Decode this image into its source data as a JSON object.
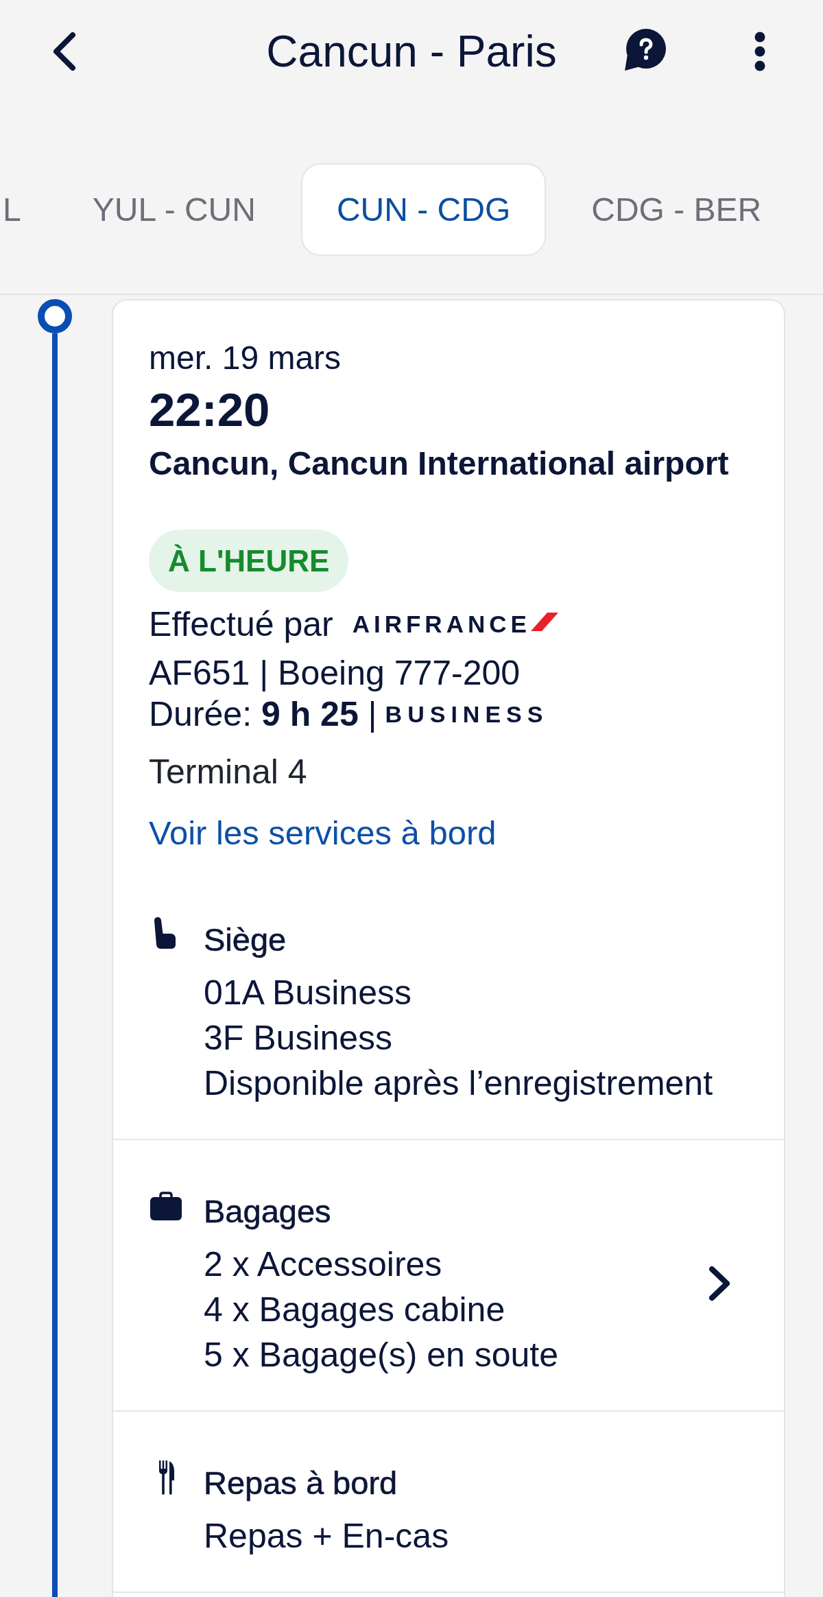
{
  "header": {
    "title": "Cancun - Paris"
  },
  "tabs": [
    {
      "label": "L",
      "selected": false
    },
    {
      "label": "YUL - CUN",
      "selected": false
    },
    {
      "label": "CUN - CDG",
      "selected": true
    },
    {
      "label": "CDG - BER",
      "selected": false
    }
  ],
  "segment": {
    "date": "mer. 19 mars",
    "time": "22:20",
    "airport": "Cancun, Cancun International airport",
    "status": {
      "label": "À L'HEURE",
      "kind": "on_time"
    },
    "operated_by": "Effectué par",
    "airline_logo": "AIRFRANCE",
    "flight": "AF651 | Boeing 777-200",
    "duration": "Durée: **9 h 25** |",
    "cabin": "BUSINESS",
    "terminal": "Terminal 4",
    "services_link": "Voir les services à bord"
  },
  "sections": [
    {
      "kind": "seat",
      "title": "Siège",
      "lines": [
        "01A Business",
        "3F Business",
        "Disponible après l’enregistrement"
      ],
      "expandable": false
    },
    {
      "kind": "baggage",
      "title": "Bagages",
      "lines": [
        "2 x Accessoires",
        "4 x Bagages cabine",
        "5 x Bagage(s) en soute"
      ],
      "expandable": true
    },
    {
      "kind": "meal",
      "title": "Repas à bord",
      "lines": [
        "Repas + En-cas"
      ],
      "expandable": false
    }
  ]
}
